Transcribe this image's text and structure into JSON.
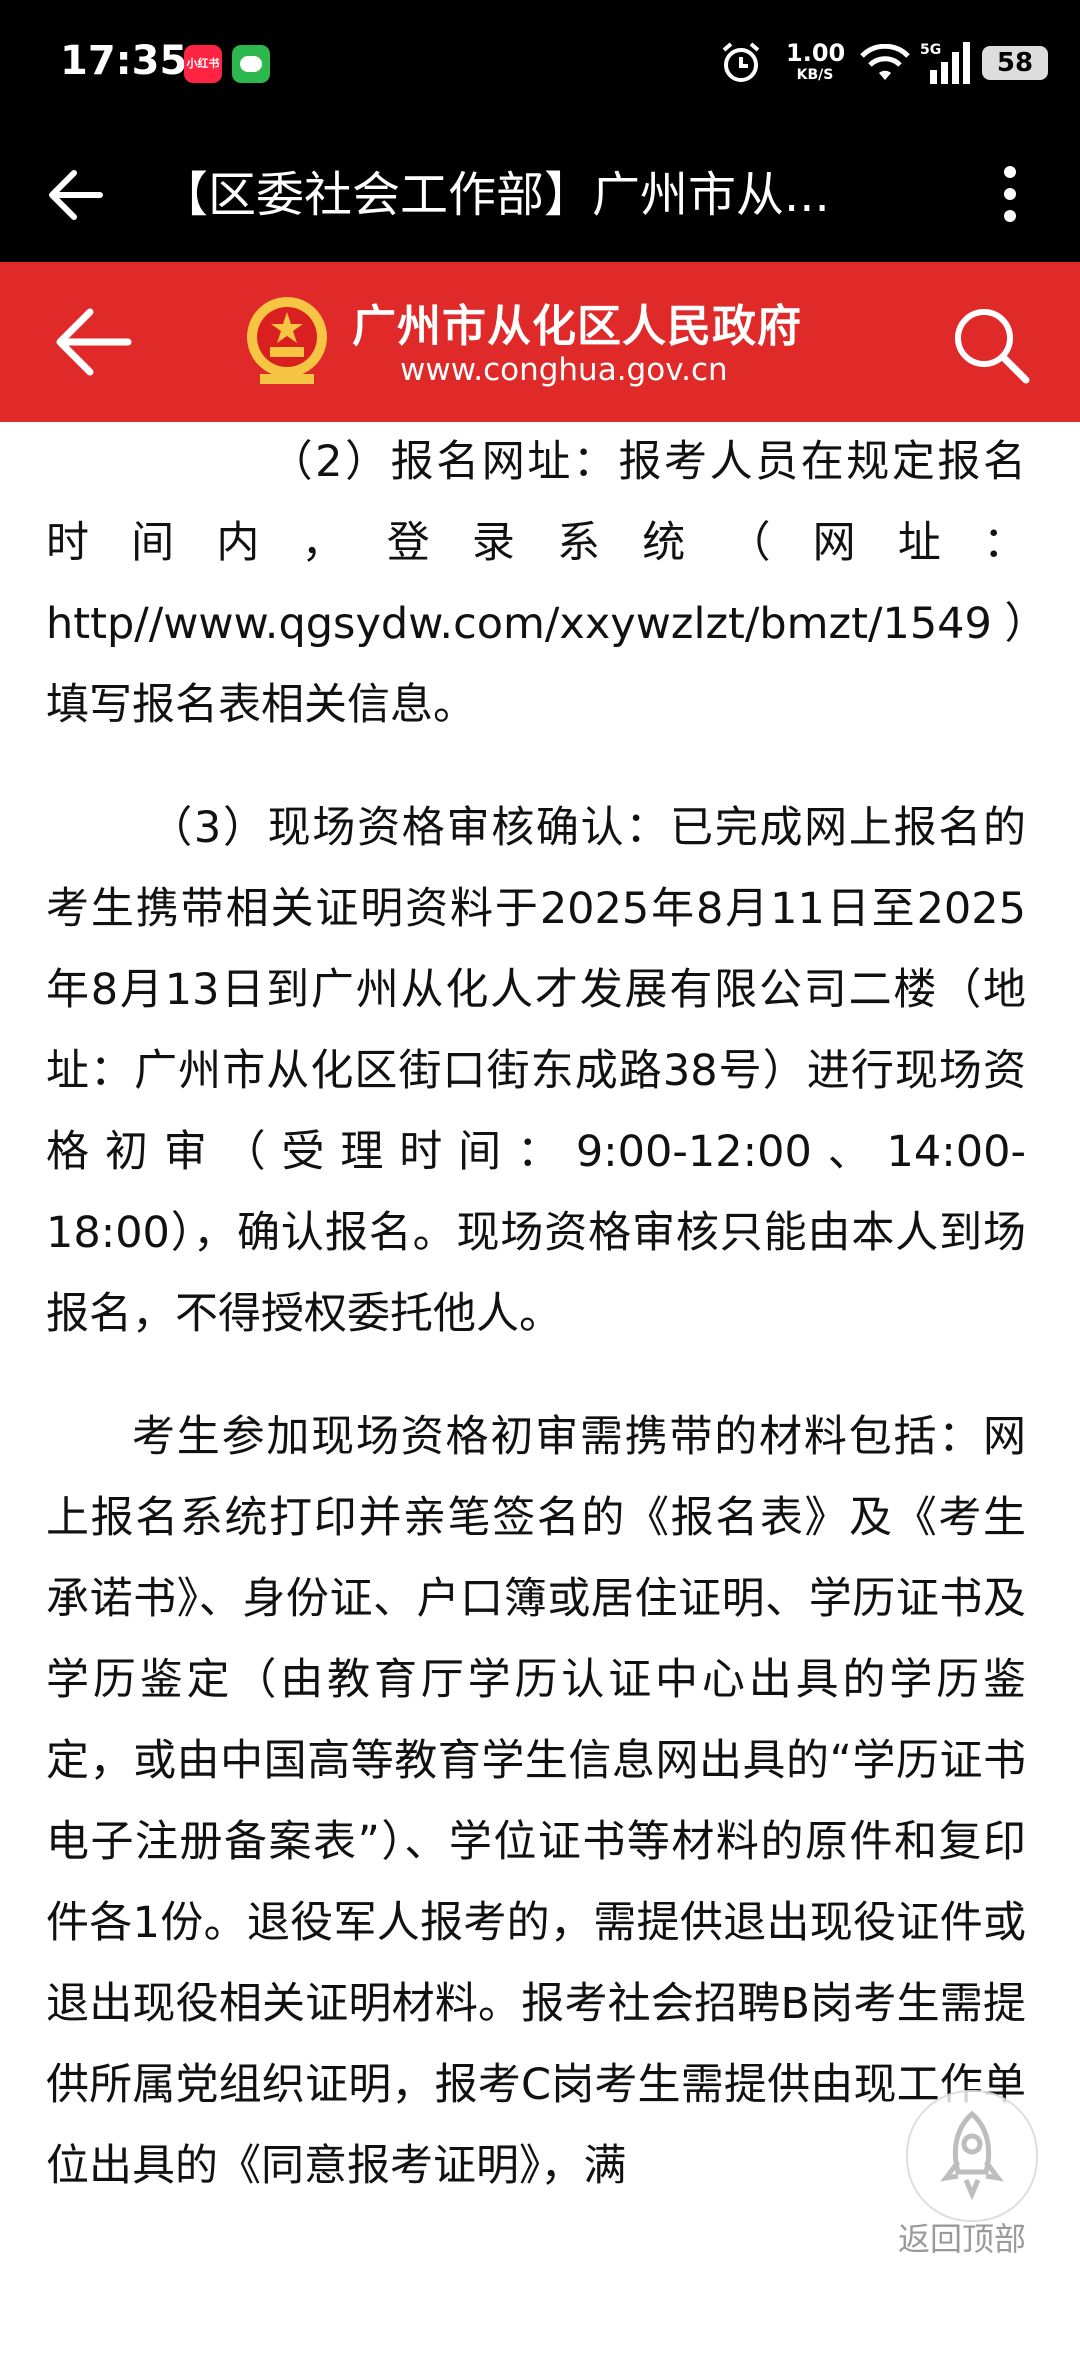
{
  "status_bar": {
    "time": "17:35",
    "app1_label": "小红书",
    "net_speed": "1.00",
    "net_unit": "KB/S",
    "signal_label": "5G",
    "battery": "58"
  },
  "app_bar": {
    "title": "【区委社会工作部】广州市从..."
  },
  "site_header": {
    "name": "广州市从化区人民政府",
    "url": "www.conghua.gov.cn",
    "brand_color": "#e02929"
  },
  "article": {
    "paragraphs": [
      "（2）报名网址：报考人员在规定报名时间内，登录系统（网址：http//www.qgsydw.com/xxywzlzt/bmzt/1549）填写报名表相关信息。",
      "（3）现场资格审核确认：已完成网上报名的考生携带相关证明资料于2025年8月11日至2025年8月13日到广州从化人才发展有限公司二楼（地址：广州市从化区街口街东成路38号）进行现场资格初审（受理时间：9:00-12:00、14:00-18:00），确认报名。现场资格审核只能由本人到场报名，不得授权委托他人。",
      "考生参加现场资格初审需携带的材料包括：网上报名系统打印并亲笔签名的《报名表》及《考生承诺书》、身份证、户口簿或居住证明、学历证书及学历鉴定（由教育厅学历认证中心出具的学历鉴定，或由中国高等教育学生信息网出具的“学历证书电子注册备案表”）、学位证书等材料的原件和复印件各1份。退役军人报考的，需提供退出现役证件或退出现役相关证明材料。报考社会招聘B岗考生需提供所属党组织证明，报考C岗考生需提供由现工作单位出具的《同意报考证明》，满"
    ]
  },
  "back_to_top": {
    "label": "返回顶部"
  }
}
